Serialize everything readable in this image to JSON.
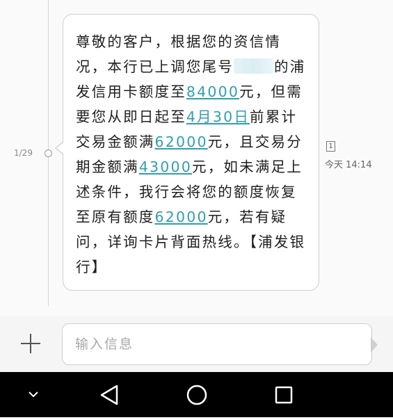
{
  "thread": {
    "counter": "1/29",
    "message_segments": [
      {
        "text": "尊敬的客户，根据您的资信情况，本行已上调您尾号"
      },
      {
        "redacted": true
      },
      {
        "text": "的浦发信用卡额度至"
      },
      {
        "text": "84000",
        "link": true
      },
      {
        "text": "元，但需要您从即日起至"
      },
      {
        "text": "4月30日",
        "link": true
      },
      {
        "text": "前累计交易金额满"
      },
      {
        "text": "62000",
        "link": true
      },
      {
        "text": "元，且交易分期金额满"
      },
      {
        "text": "43000",
        "link": true
      },
      {
        "text": "元，如未满足上述条件，我行会将您的额度恢复至原有额度"
      },
      {
        "text": "62000",
        "link": true
      },
      {
        "text": "元，若有疑问，详询卡片背面热线。【浦发银行】"
      }
    ],
    "sim_label": "1",
    "timestamp": "今天 14:14"
  },
  "composer": {
    "placeholder": "输入信息"
  },
  "navbar": {
    "items": [
      "collapse-icon",
      "back-icon",
      "home-icon",
      "recents-icon"
    ]
  },
  "colors": {
    "link": "#2f9fb0",
    "navbar_bg": "#000000"
  }
}
